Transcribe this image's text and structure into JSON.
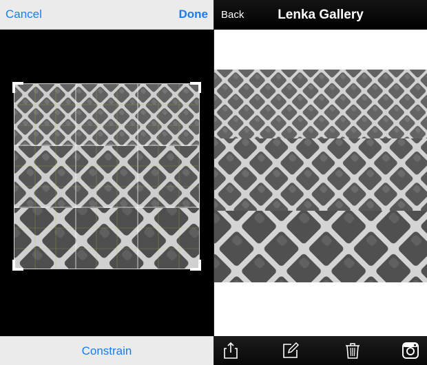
{
  "crop_editor": {
    "cancel_label": "Cancel",
    "done_label": "Done",
    "constrain_label": "Constrain"
  },
  "gallery": {
    "back_label": "Back",
    "title": "Lenka Gallery",
    "toolbar": {
      "icons": [
        "share-icon",
        "edit-icon",
        "trash-icon",
        "instagram-icon"
      ]
    }
  },
  "colors": {
    "accent": "#1a7cf0",
    "light_bar": "#ebebeb",
    "dark_bar": "#000000",
    "photo_paving": "#6e6e6e",
    "photo_grout": "#d8d8d8"
  }
}
